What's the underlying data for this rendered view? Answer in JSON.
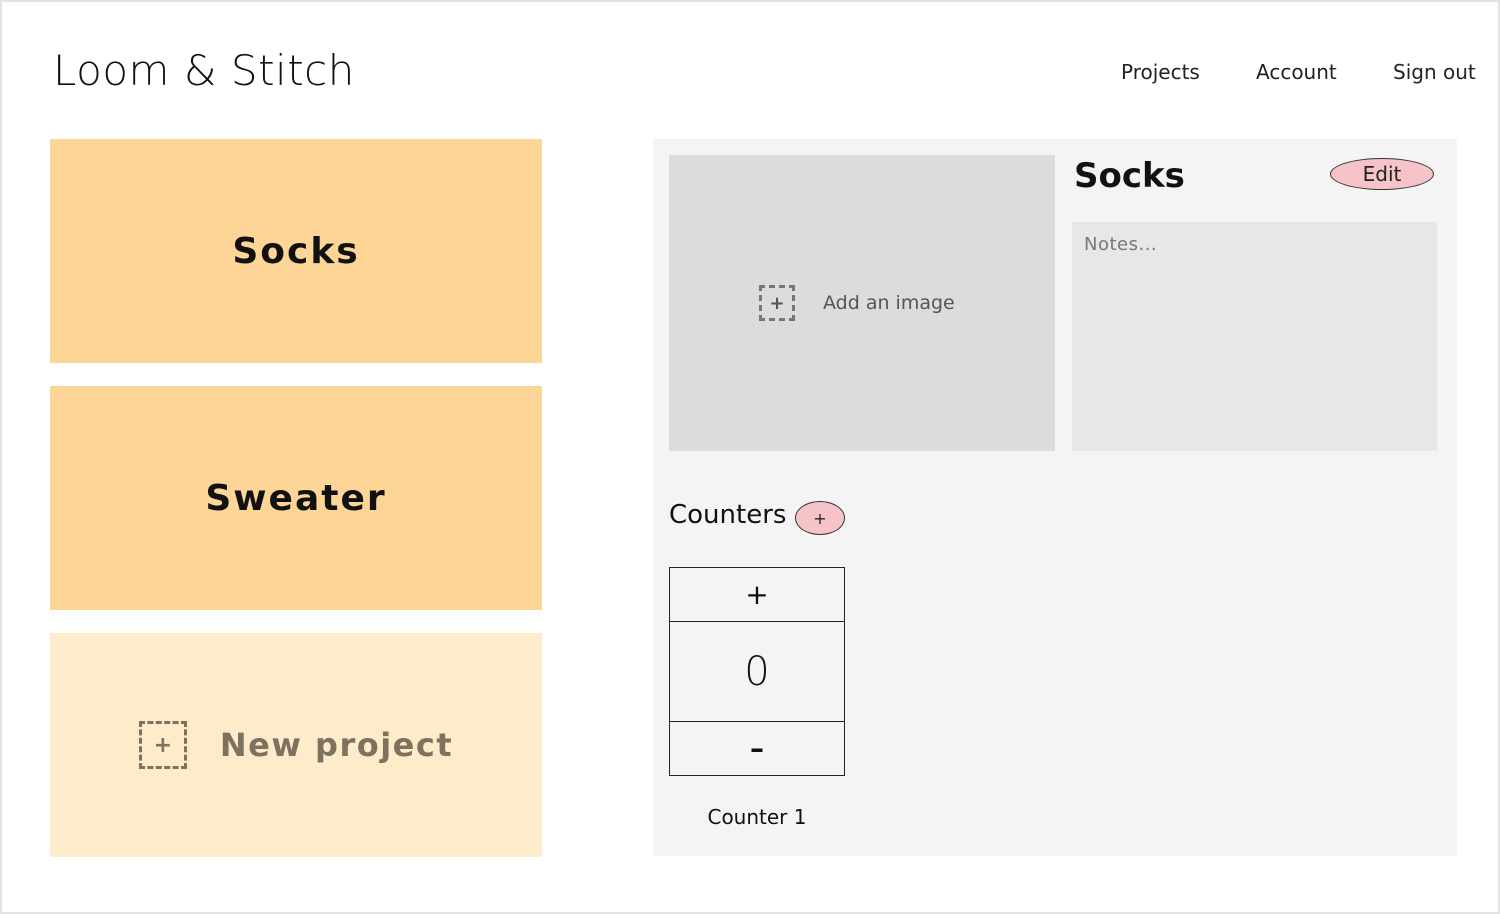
{
  "app": {
    "logo": "Loom & Stitch"
  },
  "nav": {
    "projects": "Projects",
    "account": "Account",
    "sign_out": "Sign out"
  },
  "projects": [
    {
      "label": "Socks"
    },
    {
      "label": "Sweater"
    }
  ],
  "new_project": {
    "icon": "+",
    "label": "New project"
  },
  "detail": {
    "image_hint": "Add an image",
    "image_icon": "+",
    "title": "Socks",
    "edit_label": "Edit",
    "notes_placeholder": "Notes...",
    "notes_value": "",
    "counters_label": "Counters",
    "add_counter_label": "+",
    "counters": [
      {
        "increment_label": "+",
        "value": "0",
        "decrement_label": "–",
        "name": "Counter 1"
      }
    ]
  },
  "colors": {
    "card": "#fdd596",
    "new_card": "#fdebc9",
    "panel": "#f4f4f4",
    "accent_button": "#f6c3c8"
  }
}
